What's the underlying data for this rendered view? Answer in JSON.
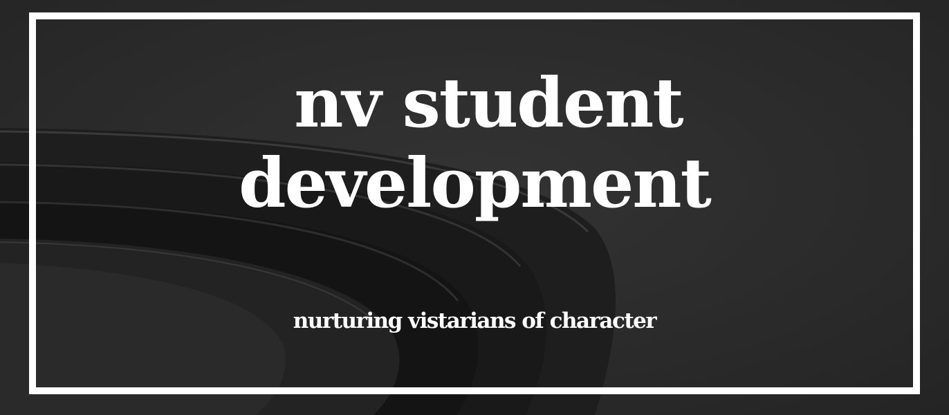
{
  "hero": {
    "title_line1": "nv student",
    "title_line2": "development",
    "tagline": "nurturing vistarians of character"
  },
  "colors": {
    "background": "#2c2c2c",
    "frame": "#ffffff",
    "text": "#ffffff"
  }
}
